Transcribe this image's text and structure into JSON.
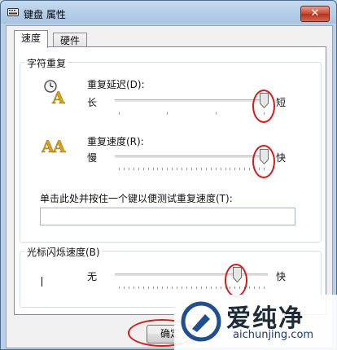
{
  "window": {
    "title": "键盘 属性",
    "close_glyph": "✕"
  },
  "tabs": [
    {
      "label": "速度",
      "active": true
    },
    {
      "label": "硬件",
      "active": false
    }
  ],
  "char_repeat": {
    "group_title": "字符重复",
    "delay": {
      "label": "重复延迟(D):",
      "min_label": "长",
      "max_label": "短",
      "value": 1.0
    },
    "rate": {
      "label": "重复速度(R):",
      "min_label": "慢",
      "max_label": "快",
      "value": 1.0
    },
    "test_label": "单击此处并按住一个键以便测试重复速度(T):",
    "test_value": ""
  },
  "cursor_blink": {
    "group_title": "光标闪烁速度(B)",
    "min_label": "无",
    "max_label": "快",
    "value": 0.82
  },
  "buttons": {
    "ok": "确定"
  },
  "watermark": {
    "text_cn": "爱纯净",
    "text_en": "aichunjing.com"
  },
  "icons": {
    "window": "keyboard-icon",
    "delay": "clock-letter-icon",
    "rate": "double-letter-icon",
    "blink": "text-cursor-icon"
  },
  "colors": {
    "highlight_circle": "#d21b1b",
    "close_button": "#c8452f"
  }
}
